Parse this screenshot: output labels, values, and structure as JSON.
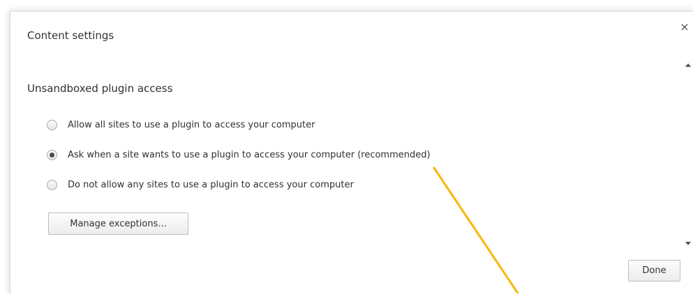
{
  "dialog": {
    "title": "Content settings",
    "close_glyph": "×"
  },
  "section": {
    "title": "Unsandboxed plugin access",
    "options": [
      {
        "label": "Allow all sites to use a plugin to access your computer",
        "selected": false
      },
      {
        "label": "Ask when a site wants to use a plugin to access your computer (recommended)",
        "selected": true
      },
      {
        "label": "Do not allow any sites to use a plugin to access your computer",
        "selected": false
      }
    ],
    "manage_label": "Manage exceptions..."
  },
  "footer": {
    "done_label": "Done"
  },
  "colors": {
    "annotation_line": "#f5b800"
  }
}
